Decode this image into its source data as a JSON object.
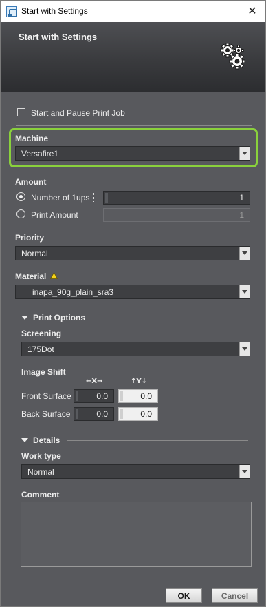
{
  "window": {
    "title": "Start with Settings"
  },
  "header": {
    "title": "Start with Settings",
    "icon": "gears-icon"
  },
  "start_pause": {
    "label": "Start and Pause Print Job",
    "checked": false
  },
  "machine": {
    "label": "Machine",
    "value": "Versafire1",
    "highlight_color": "#8ad13c"
  },
  "amount": {
    "label": "Amount",
    "options": [
      {
        "label": "Number of 1ups",
        "value": "1",
        "selected": true
      },
      {
        "label": "Print Amount",
        "value": "1",
        "selected": false
      }
    ]
  },
  "priority": {
    "label": "Priority",
    "value": "Normal"
  },
  "material": {
    "label": "Material",
    "value": "inapa_90g_plain_sra3",
    "warning_icon": "warning-icon"
  },
  "print_options": {
    "label": "Print Options",
    "screening": {
      "label": "Screening",
      "value": "175Dot"
    },
    "image_shift": {
      "label": "Image Shift",
      "x_header": "←X→",
      "y_header": "↑Y↓",
      "rows": [
        {
          "label": "Front Surface",
          "x": "0.0",
          "y": "0.0"
        },
        {
          "label": "Back Surface",
          "x": "0.0",
          "y": "0.0"
        }
      ]
    }
  },
  "details": {
    "label": "Details",
    "work_type": {
      "label": "Work type",
      "value": "Normal"
    },
    "comment": {
      "label": "Comment",
      "value": ""
    }
  },
  "buttons": {
    "ok": "OK",
    "cancel": "Cancel"
  },
  "colors": {
    "panel": "#58595d",
    "field": "#3e3f42",
    "accent": "#8ad13c"
  }
}
